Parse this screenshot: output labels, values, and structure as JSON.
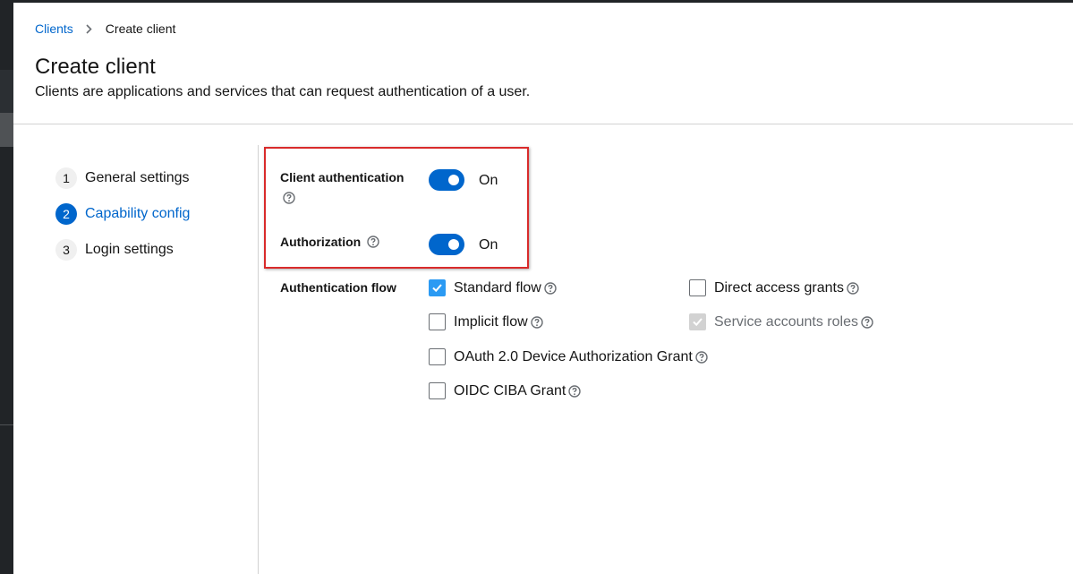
{
  "breadcrumb": {
    "parent": "Clients",
    "current": "Create client"
  },
  "header": {
    "title": "Create client",
    "description": "Clients are applications and services that can request authentication of a user."
  },
  "wizard": {
    "steps": [
      {
        "number": "1",
        "label": "General settings"
      },
      {
        "number": "2",
        "label": "Capability config"
      },
      {
        "number": "3",
        "label": "Login settings"
      }
    ],
    "current_step": 2
  },
  "form": {
    "client_authentication": {
      "label": "Client authentication",
      "state": "On",
      "enabled": true
    },
    "authorization": {
      "label": "Authorization",
      "state": "On",
      "enabled": true
    },
    "authentication_flow": {
      "label": "Authentication flow",
      "options": [
        {
          "label": "Standard flow",
          "checked": true,
          "disabled": false
        },
        {
          "label": "Direct access grants",
          "checked": false,
          "disabled": false
        },
        {
          "label": "Implicit flow",
          "checked": false,
          "disabled": false
        },
        {
          "label": "Service accounts roles",
          "checked": true,
          "disabled": true
        },
        {
          "label": "OAuth 2.0 Device Authorization Grant",
          "checked": false,
          "disabled": false
        },
        {
          "label": "OIDC CIBA Grant",
          "checked": false,
          "disabled": false
        }
      ]
    }
  },
  "colors": {
    "accent": "#0066cc",
    "highlight": "#d92b2b",
    "checkbox_checked": "#2b9af3"
  },
  "icons": [
    "chevron-right-icon",
    "help-icon",
    "check-icon"
  ]
}
